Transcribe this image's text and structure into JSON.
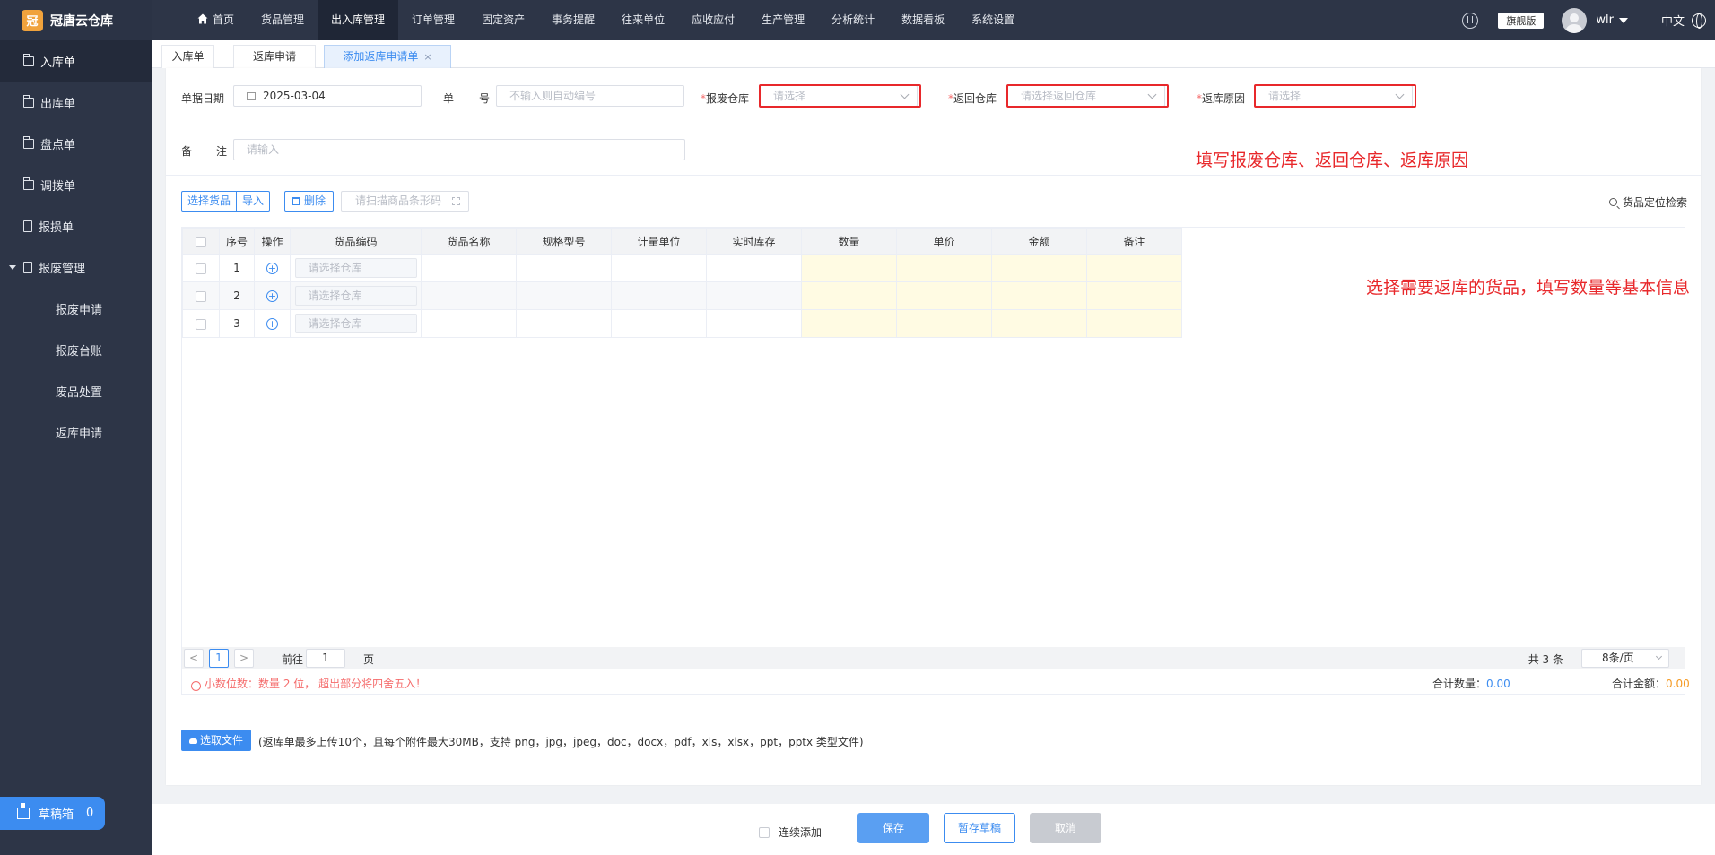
{
  "app": {
    "logo_text": "冠唐云仓库",
    "logo_mark": "冠"
  },
  "topnav": {
    "items": [
      {
        "label": "首页"
      },
      {
        "label": "货品管理"
      },
      {
        "label": "出入库管理"
      },
      {
        "label": "订单管理"
      },
      {
        "label": "固定资产"
      },
      {
        "label": "事务提醒"
      },
      {
        "label": "往来单位"
      },
      {
        "label": "应收应付"
      },
      {
        "label": "生产管理"
      },
      {
        "label": "分析统计"
      },
      {
        "label": "数据看板"
      },
      {
        "label": "系统设置"
      }
    ],
    "active": "出入库管理",
    "edition": "旗舰版",
    "username": "wlr",
    "language": "中文"
  },
  "sidebar": {
    "items": [
      {
        "label": "入库单",
        "icon": "folder-in-icon"
      },
      {
        "label": "出库单",
        "icon": "folder-out-icon"
      },
      {
        "label": "盘点单",
        "icon": "folder-check-icon"
      },
      {
        "label": "调拨单",
        "icon": "folder-icon"
      },
      {
        "label": "报损单",
        "icon": "document-icon"
      },
      {
        "label": "报废管理",
        "icon": "document-icon"
      }
    ],
    "sub_items": [
      {
        "label": "报废申请"
      },
      {
        "label": "报废台账"
      },
      {
        "label": "废品处置"
      },
      {
        "label": "返库申请"
      }
    ],
    "draft_label": "草稿箱",
    "draft_count": "0"
  },
  "tabs": [
    {
      "label": "入库单"
    },
    {
      "label": "返库申请"
    },
    {
      "label": "添加返库申请单",
      "close": "×"
    }
  ],
  "form": {
    "date_label": "单据日期",
    "date_value": "2025-03-04",
    "number_label_1": "单",
    "number_label_2": "号",
    "number_placeholder": "不输入则自动编号",
    "req_mark": "*",
    "scrap_wh_label": "报废仓库",
    "scrap_wh_placeholder": "请选择",
    "return_wh_label": "返回仓库",
    "return_wh_placeholder": "请选择返回仓库",
    "reason_label": "返库原因",
    "reason_placeholder": "请选择",
    "remark_label_1": "备",
    "remark_label_2": "注",
    "remark_placeholder": "请输入"
  },
  "annotations": {
    "top": "填写报废仓库、返回仓库、返库原因",
    "table": "选择需要返库的货品，填写数量等基本信息",
    "color": "#e8282b"
  },
  "toolbar": {
    "select_goods": "选择货品",
    "import": "导入",
    "delete": "删除",
    "scan_placeholder": "请扫描商品条形码",
    "locate": "货品定位检索"
  },
  "table": {
    "headers": [
      "序号",
      "操作",
      "货品编码",
      "货品名称",
      "规格型号",
      "计量单位",
      "实时库存",
      "数量",
      "单价",
      "金额",
      "备注"
    ],
    "rows": [
      {
        "no": "1",
        "code_placeholder": "请选择仓库"
      },
      {
        "no": "2",
        "code_placeholder": "请选择仓库"
      },
      {
        "no": "3",
        "code_placeholder": "请选择仓库"
      }
    ]
  },
  "pager": {
    "prev": "<",
    "current": "1",
    "next": ">",
    "goto_label": "前往",
    "goto_value": "1",
    "page_label": "页",
    "total": "共 3 条",
    "page_size": "8条/页"
  },
  "summary": {
    "warning_icon": "!",
    "warning": "小数位数：数量 2 位， 超出部分将四舍五入！",
    "total_qty_label": "合计数量：",
    "total_qty": "0.00",
    "total_amt_label": "合计金额：",
    "total_amt": "0.00"
  },
  "upload": {
    "button": "选取文件",
    "hint": "(返库单最多上传10个，且每个附件最大30MB，支持 png，jpg，jpeg，doc，docx，pdf，xls，xlsx，ppt，pptx 类型文件)"
  },
  "actions": {
    "continuous_add": "连续添加",
    "save": "保存",
    "save_draft": "暂存草稿",
    "cancel": "取消"
  }
}
